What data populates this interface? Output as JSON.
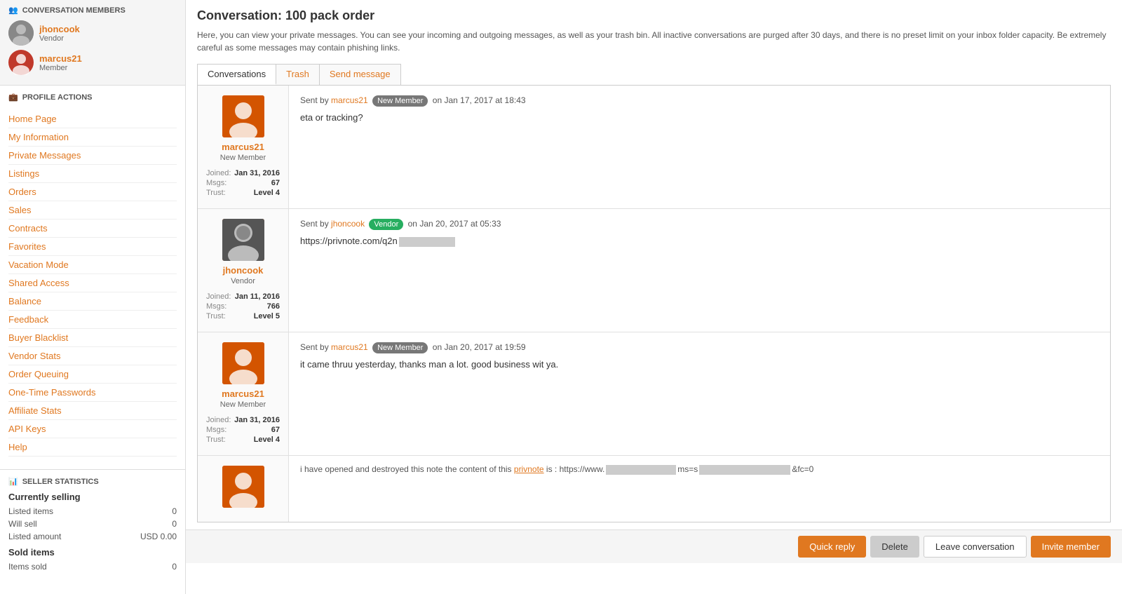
{
  "sidebar": {
    "conv_members_title": "CONVERSATION MEMBERS",
    "members": [
      {
        "name": "jhoncook",
        "role": "Vendor",
        "type": "vendor"
      },
      {
        "name": "marcus21",
        "role": "Member",
        "type": "member"
      }
    ],
    "profile_actions_title": "PROFILE ACTIONS",
    "nav_links": [
      "Home Page",
      "My Information",
      "Private Messages",
      "Listings",
      "Orders",
      "Sales",
      "Contracts",
      "Favorites",
      "Vacation Mode",
      "Shared Access",
      "Balance",
      "Feedback",
      "Buyer Blacklist",
      "Vendor Stats",
      "Order Queuing",
      "One-Time Passwords",
      "Affiliate Stats",
      "API Keys",
      "Help"
    ],
    "seller_stats_title": "SELLER STATISTICS",
    "currently_selling_label": "Currently selling",
    "stat_listed_items": "Listed items",
    "stat_listed_items_val": "0",
    "stat_will_sell": "Will sell",
    "stat_will_sell_val": "0",
    "stat_listed_amount": "Listed amount",
    "stat_listed_amount_val": "USD 0.00",
    "sold_items_label": "Sold items",
    "stat_items_sold": "Items sold",
    "stat_items_sold_val": "0"
  },
  "main": {
    "title": "Conversation: 100 pack order",
    "description": "Here, you can view your private messages. You can see your incoming and outgoing messages, as well as your trash bin. All inactive conversations are purged after 30 days, and there is no preset limit on your inbox folder capacity. Be extremely careful as some messages may contain phishing links.",
    "tabs": [
      {
        "label": "Conversations",
        "active": true
      },
      {
        "label": "Trash",
        "active": false
      },
      {
        "label": "Send message",
        "active": false
      }
    ],
    "messages": [
      {
        "sender_name": "marcus21",
        "sender_badge": "New Member",
        "sender_badge_type": "new-member",
        "date": "on Jan 17, 2017 at 18:43",
        "text": "eta or tracking?",
        "user_name": "marcus21",
        "user_role": "New Member",
        "user_joined": "Jan 31, 2016",
        "user_msgs": "67",
        "user_trust": "Level 4",
        "avatar_type": "default"
      },
      {
        "sender_name": "jhoncook",
        "sender_badge": "Vendor",
        "sender_badge_type": "vendor",
        "date": "on Jan 20, 2017 at 05:33",
        "text": "https://privnote.com/q2n",
        "text_has_redact": true,
        "user_name": "jhoncook",
        "user_role": "Vendor",
        "user_joined": "Jan 11, 2016",
        "user_msgs": "766",
        "user_trust": "Level 5",
        "avatar_type": "photo"
      },
      {
        "sender_name": "marcus21",
        "sender_badge": "New Member",
        "sender_badge_type": "new-member",
        "date": "on Jan 20, 2017 at 19:59",
        "text": "it came thruu yesterday, thanks man a lot. good business wit ya.",
        "user_name": "marcus21",
        "user_role": "New Member",
        "user_joined": "Jan 31, 2016",
        "user_msgs": "67",
        "user_trust": "Level 4",
        "avatar_type": "default"
      },
      {
        "sender_name": "",
        "sender_badge": "",
        "sender_badge_type": "",
        "date": "",
        "text": "i have opened and destroyed this note the content of this privnote is : https://www.",
        "text_draft": true,
        "user_name": "",
        "user_role": "",
        "user_joined": "",
        "user_msgs": "",
        "user_trust": "",
        "avatar_type": "default"
      }
    ],
    "action_bar": {
      "quick_reply": "Quick reply",
      "delete": "Delete",
      "leave_conversation": "Leave conversation",
      "invite_member": "Invite member"
    }
  }
}
